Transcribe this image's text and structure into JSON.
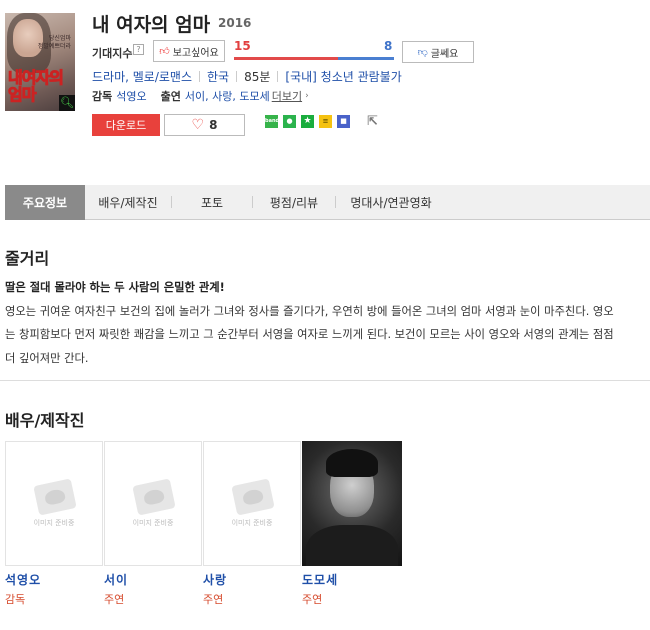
{
  "movie": {
    "title": "내 여자의 엄마",
    "year": "2016",
    "poster_title": "내여자의\n엄마",
    "poster_tagline": "당신엄마\n정말예쁘더라"
  },
  "expect": {
    "label": "기대지수",
    "help": "?",
    "want_label": "보고싶어요",
    "want_count": "15",
    "meh_label": "글쎄요",
    "meh_count": "8",
    "want_ratio": 0.65
  },
  "meta": {
    "genre": "드라마, 멜로/로맨스",
    "country": "한국",
    "runtime": "85분",
    "rating": "[국내] 청소년 관람불가",
    "director_label": "감독",
    "director": "석영오",
    "cast_label": "출연",
    "cast": "서이, 사랑, 도모세",
    "more": "더보기"
  },
  "actions": {
    "download": "다운로드",
    "like_count": "8"
  },
  "share_icons": [
    "band-icon",
    "line-icon",
    "star-icon",
    "kakaostory-icon",
    "naver-memo-icon",
    "share-external-icon"
  ],
  "tabs": [
    "주요정보",
    "배우/제작진",
    "포토",
    "평점/리뷰",
    "명대사/연관영화"
  ],
  "synopsis": {
    "heading": "줄거리",
    "lead": "딸은 절대 몰라야 하는 두 사람의 은밀한 관계!",
    "body": "영오는 귀여운 여자친구 보건의 집에 놀러가 그녀와 정사를 즐기다가, 우연히 방에 들어온 그녀의 엄마 서영과 눈이 마주친다. 영오는 창피함보다 먼저 짜릿한 쾌감을 느끼고 그 순간부터 서영을 여자로 느끼게 된다. 보건이 모르는 사이 영오와 서영의 관계는 점점 더 깊어져만 간다."
  },
  "cast_section": {
    "heading": "배우/제작진",
    "placeholder": "이미지 준비중",
    "people": [
      {
        "name": "석영오",
        "role": "감독"
      },
      {
        "name": "서이",
        "role": "주연"
      },
      {
        "name": "사랑",
        "role": "주연"
      },
      {
        "name": "도모세",
        "role": "주연"
      }
    ]
  },
  "colors": {
    "accent_red": "#e8413c",
    "link_blue": "#1f4fa8",
    "bar_red": "#e24a4a",
    "bar_blue": "#4a7fd1"
  }
}
